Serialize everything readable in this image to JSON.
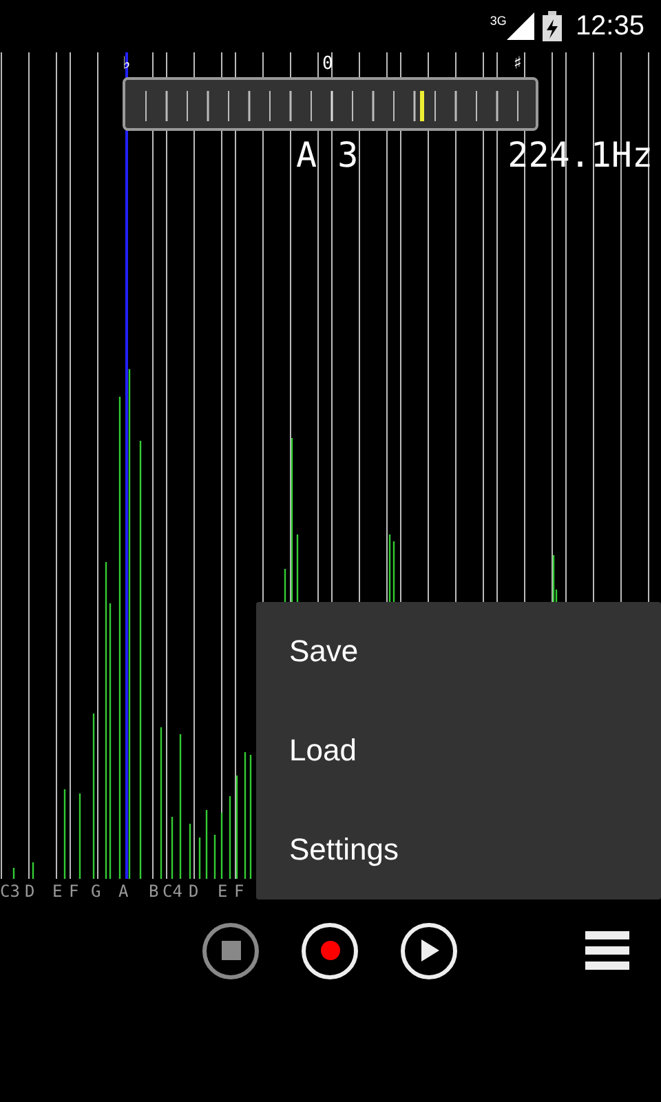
{
  "status_bar": {
    "network": "3G",
    "time": "12:35"
  },
  "meter": {
    "flat_label": "♭",
    "center_label": "0",
    "sharp_label": "♯",
    "level": 0.72,
    "note": "A 3",
    "frequency": "224.1Hz"
  },
  "note_labels": [
    "C3",
    "D",
    "E",
    "F",
    "G",
    "A",
    "B",
    "C4",
    "D",
    "E",
    "F"
  ],
  "menu": {
    "items": [
      {
        "label": "Save"
      },
      {
        "label": "Load"
      },
      {
        "label": "Settings"
      }
    ]
  },
  "transport": [
    {
      "kind": "stop",
      "disabled": true
    },
    {
      "kind": "record",
      "disabled": false
    },
    {
      "kind": "play",
      "disabled": false
    }
  ]
}
